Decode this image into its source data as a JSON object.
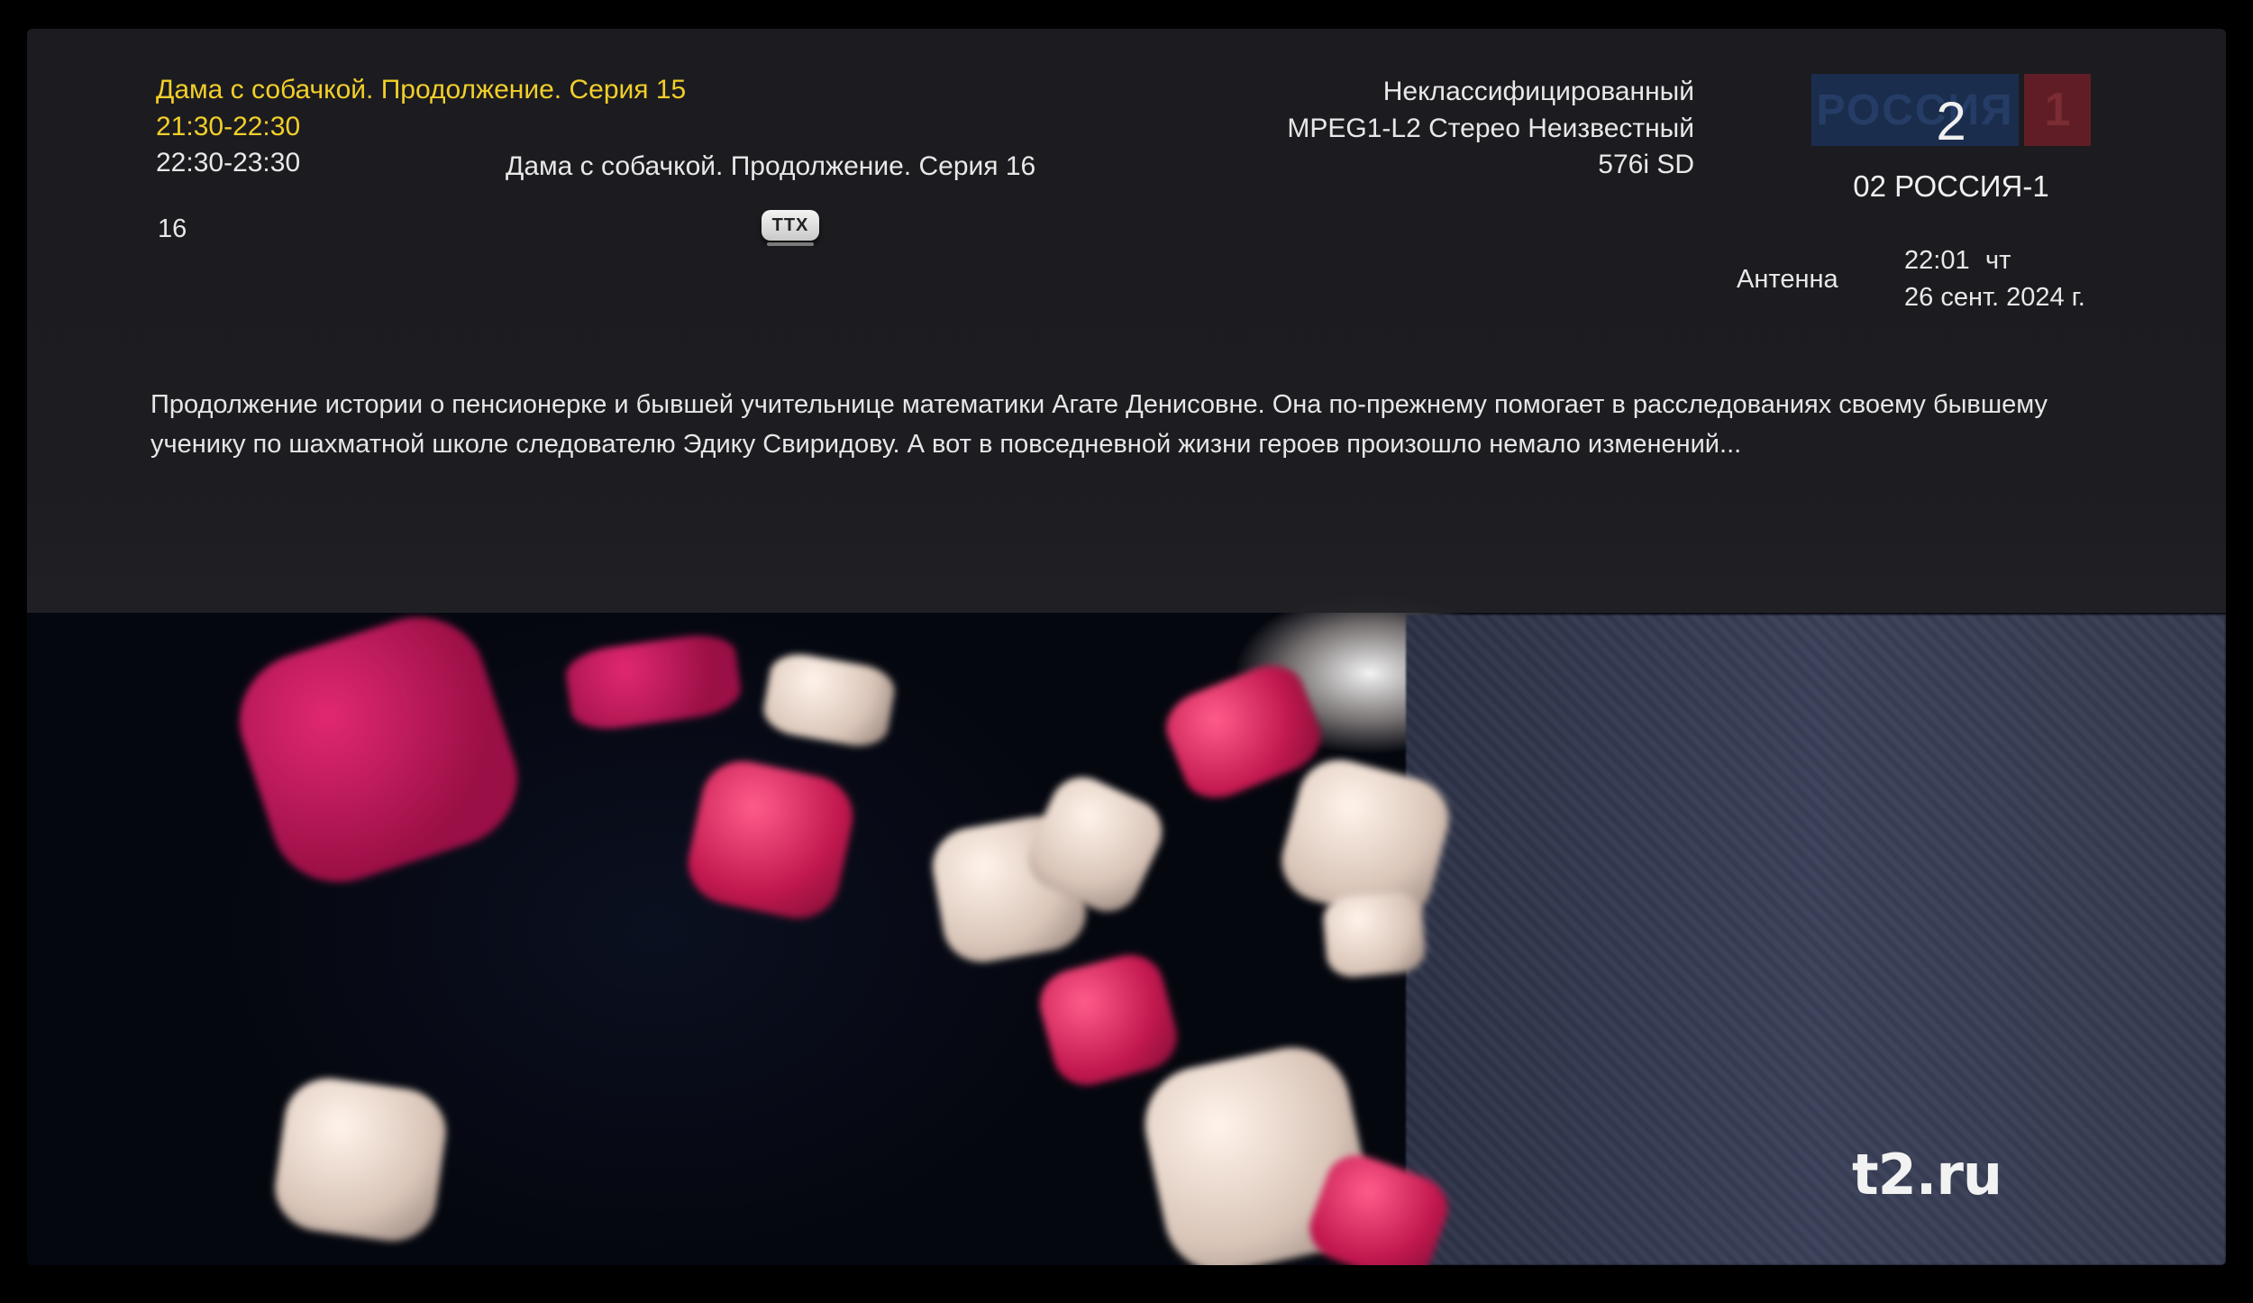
{
  "epg": {
    "current": {
      "title": "Дама с собачкой. Продолжение. Серия 15",
      "time": "21:30-22:30"
    },
    "next": {
      "time": "22:30-23:30",
      "title": "Дама с собачкой. Продолжение. Серия 16"
    },
    "age_rating": "16",
    "ttx_label": "TTX",
    "description": "Продолжение истории о пенсионерке и бывшей учительнице математики Агате Денисовне. Она по-прежнему помогает в расследованиях своему бывшему ученику по шахматной школе  следователю Эдику Свиридову. А вот в повседневной жизни героев произошло немало изменений..."
  },
  "stream_info": {
    "genre": "Неклассифицированный",
    "audio": "MPEG1-L2 Стерео Неизвестный",
    "video": "576i SD"
  },
  "channel": {
    "number": "2",
    "name": "02 РОССИЯ-1",
    "logo_text": "РОССИЯ",
    "logo_number": "1",
    "source": "Антенна"
  },
  "clock": {
    "time": "22:01",
    "weekday": "чт",
    "date": "26 сент. 2024 г."
  },
  "video_watermark": "t2.ru",
  "colors": {
    "highlight": "#f2cf2a",
    "text": "#e8e8e8",
    "overlay_bg": "#1e1e22"
  }
}
